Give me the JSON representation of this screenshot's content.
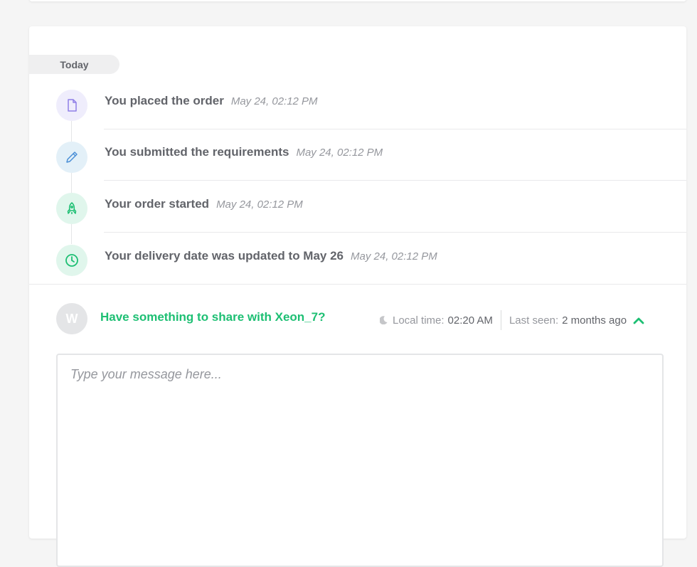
{
  "timeline": {
    "group_label": "Today",
    "events": [
      {
        "title": "You placed the order",
        "time": "May 24, 02:12 PM",
        "icon": "document-icon",
        "color": "#8f7ee7",
        "bg": "#efedfc"
      },
      {
        "title": "You submitted the requirements",
        "time": "May 24, 02:12 PM",
        "icon": "pencil-icon",
        "color": "#4a8fd6",
        "bg": "#e3f0f8"
      },
      {
        "title": "Your order started",
        "time": "May 24, 02:12 PM",
        "icon": "rocket-icon",
        "color": "#1dbf73",
        "bg": "#e0f6ec"
      },
      {
        "title": "Your delivery date was updated to May 26",
        "time": "May 24, 02:12 PM",
        "icon": "clock-icon",
        "color": "#1dbf73",
        "bg": "#e0f6ec"
      }
    ]
  },
  "chat": {
    "avatar_initial": "W",
    "prompt": "Have something to share with Xeon_7?",
    "local_time_label": "Local time:",
    "local_time_value": "02:20 AM",
    "last_seen_label": "Last seen:",
    "last_seen_value": "2 months ago",
    "message_placeholder": "Type your message here..."
  },
  "colors": {
    "accent": "#1dbf73",
    "text": "#62646a",
    "muted": "#95979d"
  }
}
